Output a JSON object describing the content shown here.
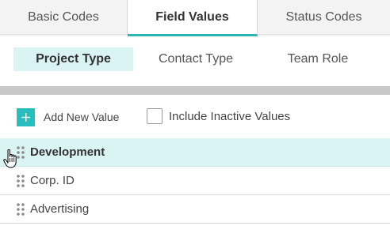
{
  "top_tabs": {
    "basic_codes": "Basic Codes",
    "field_values": "Field Values",
    "status_codes": "Status Codes"
  },
  "sub_tabs": {
    "project_type": "Project Type",
    "contact_type": "Contact Type",
    "team_role": "Team Role"
  },
  "toolbar": {
    "add_label": "Add New Value",
    "inactive_label": "Include Inactive Values",
    "inactive_checked": false
  },
  "rows": [
    {
      "label": "Development",
      "selected": true
    },
    {
      "label": "Corp. ID",
      "selected": false
    },
    {
      "label": "Advertising",
      "selected": false
    }
  ],
  "colors": {
    "accent": "#27bfbd",
    "selected_bg": "#daf3f3",
    "divider": "#c8c8c8"
  },
  "icons": {
    "add": "plus-icon",
    "drag": "drag-handle-icon",
    "cursor": "hand-cursor-icon"
  }
}
